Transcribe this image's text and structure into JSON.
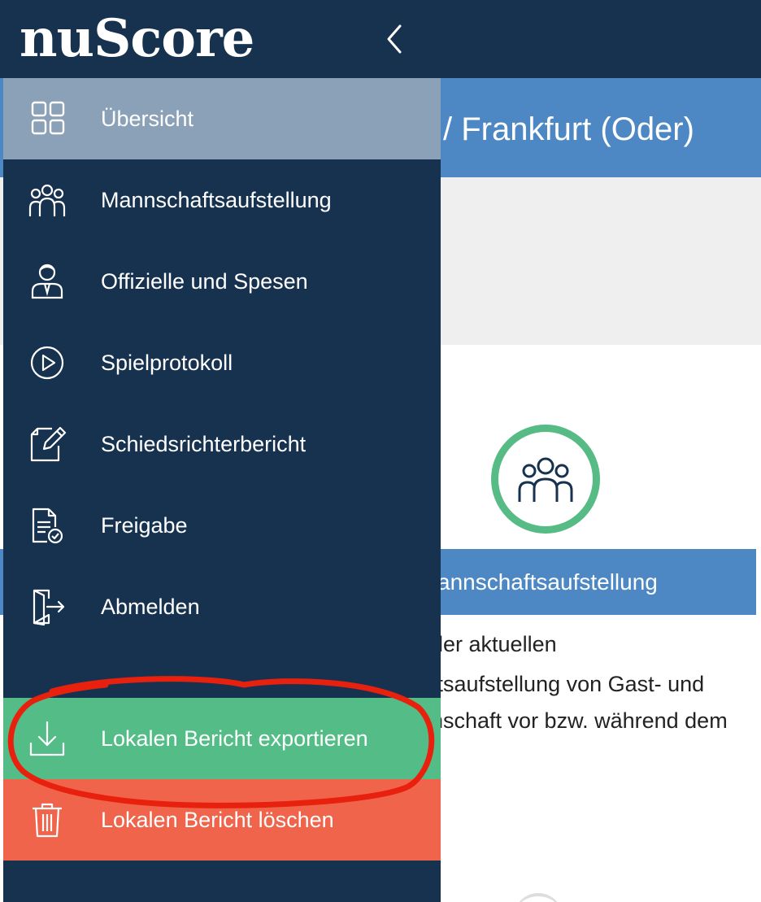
{
  "header": {
    "logo": "nuScore",
    "collapse_icon": "chevron-left-icon",
    "background_color": "#16324f"
  },
  "background_page": {
    "title_partial": "/ Frankfurt (Oder)",
    "card_title_partial": "annschaftsaufstellung",
    "card_text_lines": [
      "der aktuellen",
      "ftsaufstellung von Gast- und",
      "nschaft vor bzw. während dem"
    ],
    "card_icon": "team-icon",
    "accent_blue": "#4d88c4",
    "accent_green": "#56bb85"
  },
  "drawer": {
    "items": [
      {
        "label": "Übersicht",
        "icon": "grid-icon",
        "active": true
      },
      {
        "label": "Mannschaftsaufstellung",
        "icon": "team-icon"
      },
      {
        "label": "Offizielle und Spesen",
        "icon": "official-person-icon"
      },
      {
        "label": "Spielprotokoll",
        "icon": "play-circle-icon"
      },
      {
        "label": "Schiedsrichterbericht",
        "icon": "edit-document-icon"
      },
      {
        "label": "Freigabe",
        "icon": "document-check-icon"
      },
      {
        "label": "Abmelden",
        "icon": "logout-door-icon"
      }
    ],
    "export": {
      "label": "Lokalen Bericht exportieren",
      "icon": "download-icon",
      "color": "#54bd87"
    },
    "delete": {
      "label": "Lokalen Bericht löschen",
      "icon": "trash-icon",
      "color": "#f1644c"
    },
    "active_color": "#8ba1b8"
  },
  "annotation": {
    "shape": "red-ellipse-around-export",
    "color": "#e8210f"
  }
}
